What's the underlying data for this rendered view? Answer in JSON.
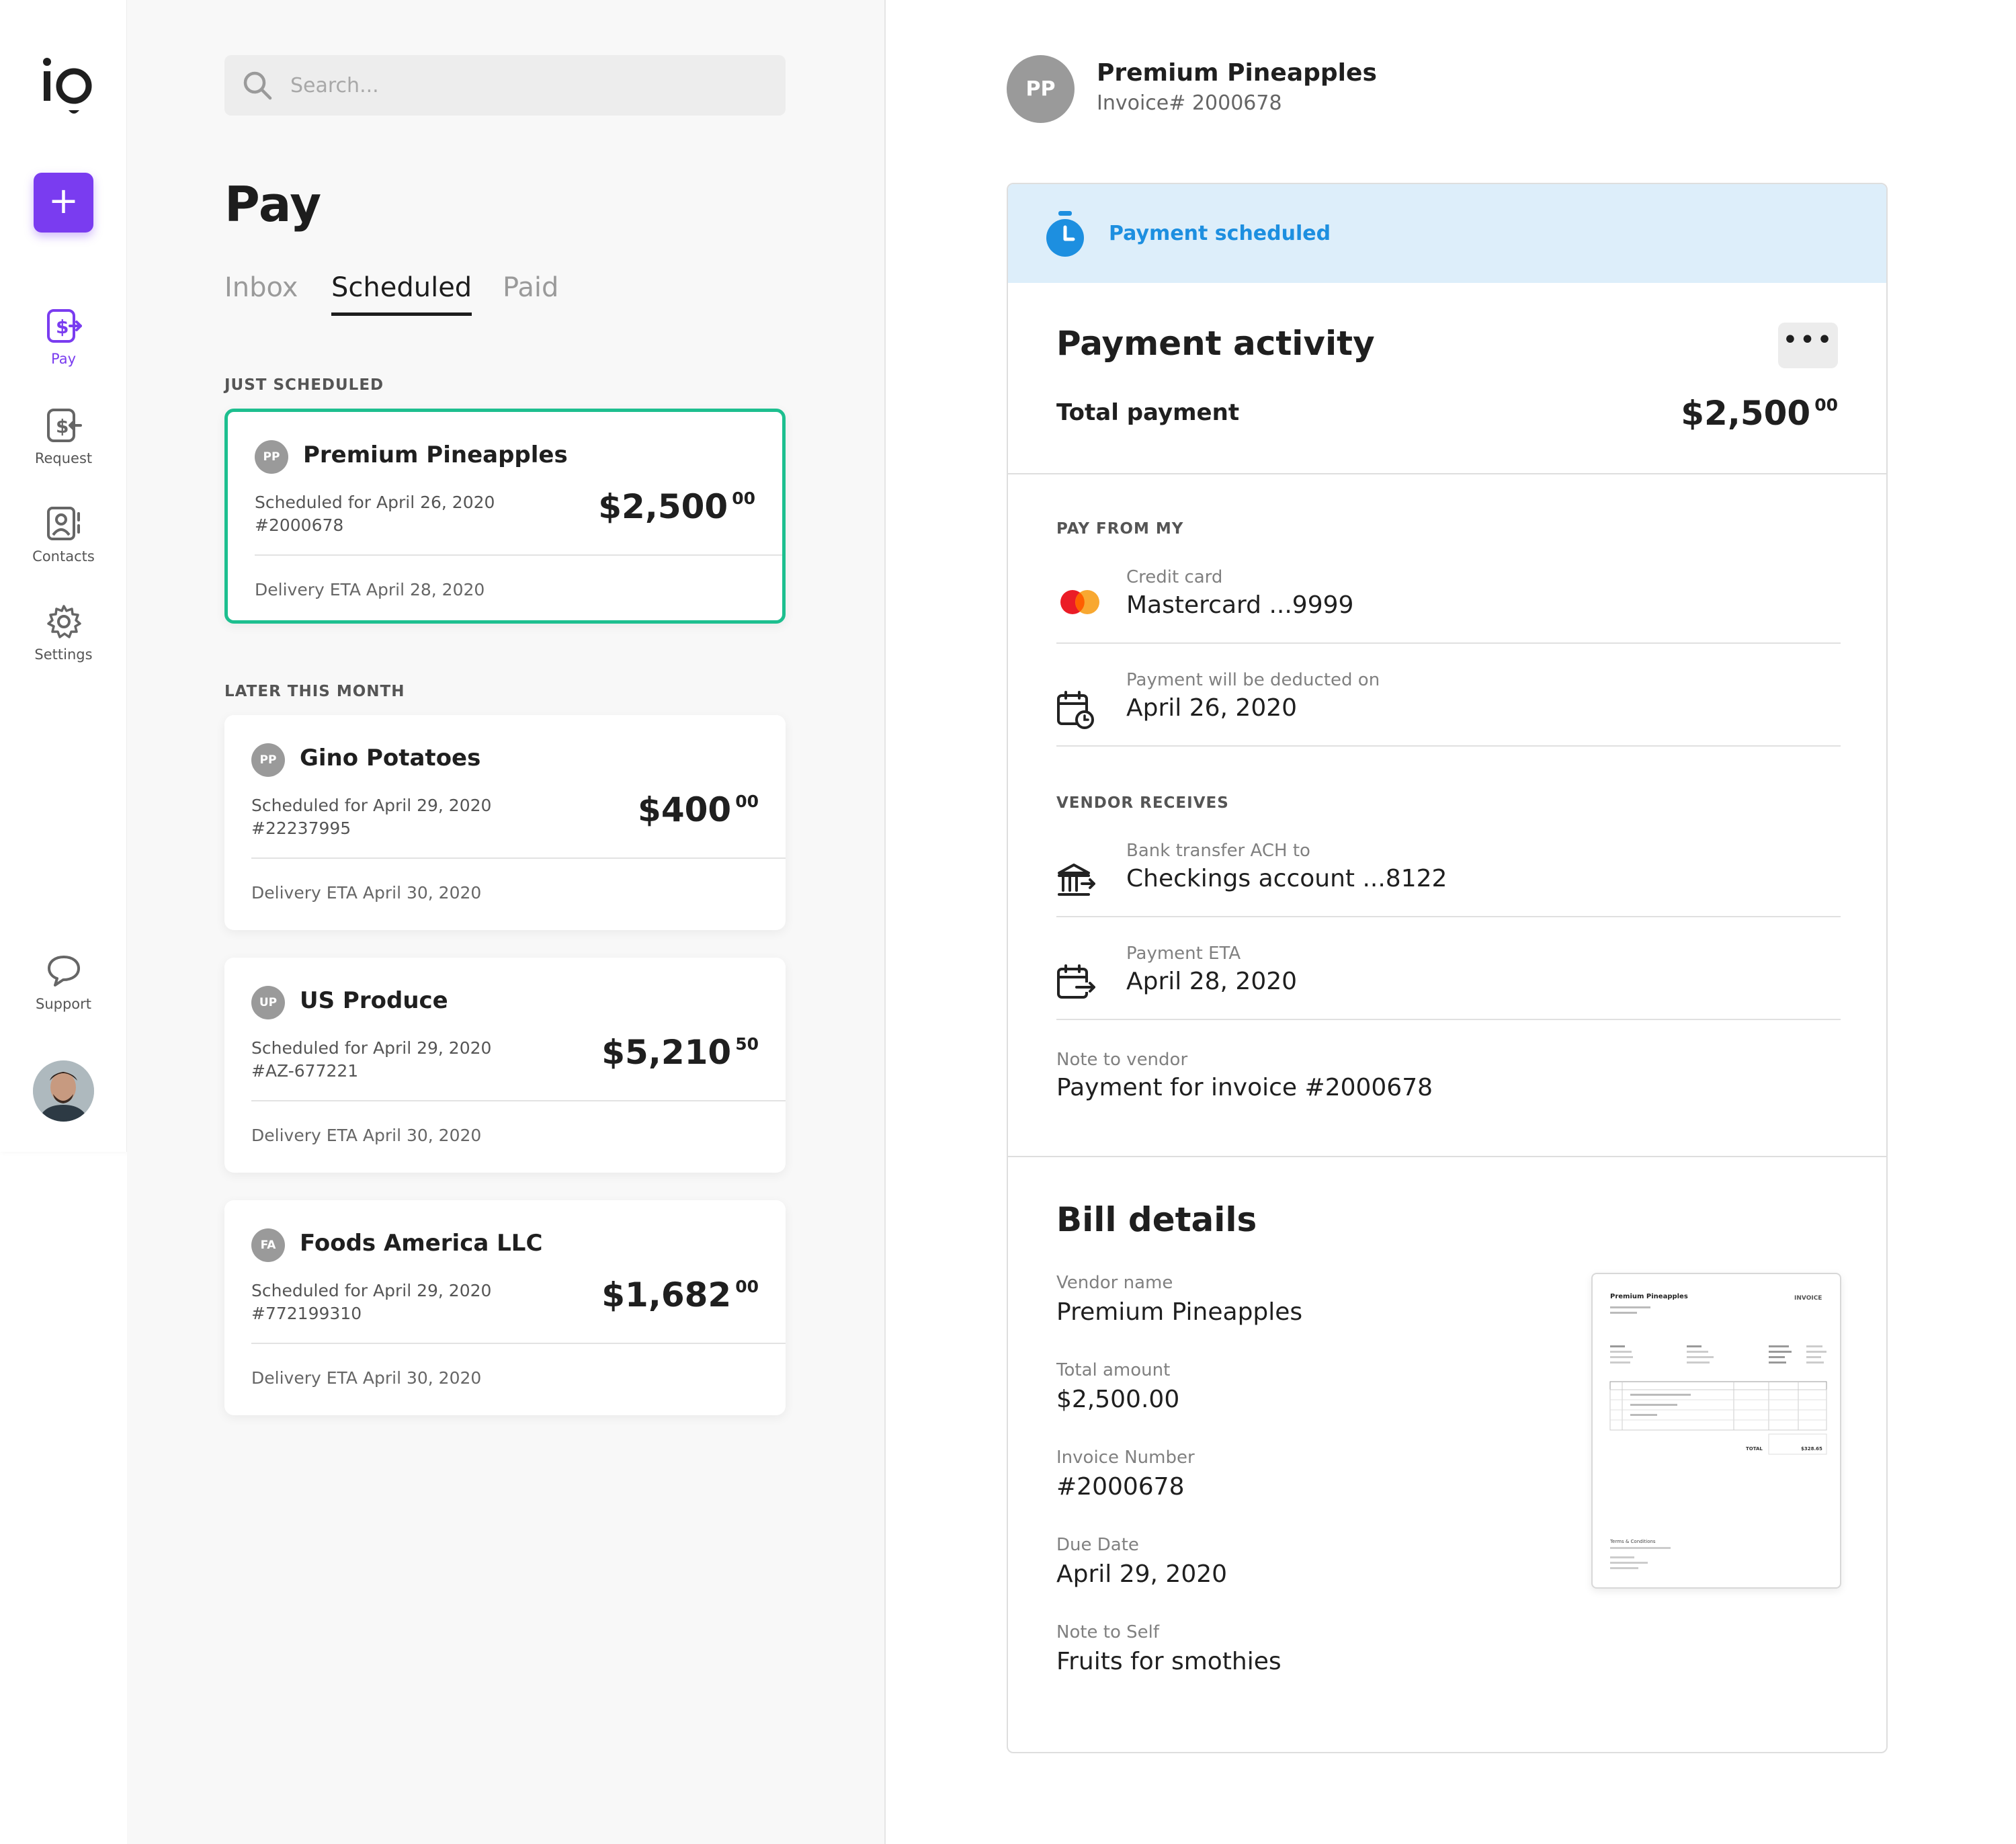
{
  "sidebar": {
    "new_label": "+",
    "items": [
      {
        "label": "Pay",
        "icon": "pay-icon"
      },
      {
        "label": "Request",
        "icon": "request-icon"
      },
      {
        "label": "Contacts",
        "icon": "contacts-icon"
      },
      {
        "label": "Settings",
        "icon": "gear-icon"
      }
    ],
    "support_label": "Support"
  },
  "search": {
    "placeholder": "Search..."
  },
  "page": {
    "title": "Pay"
  },
  "tabs": [
    {
      "label": "Inbox",
      "active": false
    },
    {
      "label": "Scheduled",
      "active": true
    },
    {
      "label": "Paid",
      "active": false
    }
  ],
  "sections": {
    "just_scheduled": "JUST SCHEDULED",
    "later_this_month": "LATER THIS MONTH"
  },
  "payments": [
    {
      "initials": "PP",
      "vendor": "Premium Pineapples",
      "scheduled": "Scheduled for April 26, 2020",
      "invoice": "#2000678",
      "amount_main": "$2,500",
      "amount_cents": "00",
      "eta": "Delivery ETA April 28, 2020"
    },
    {
      "initials": "PP",
      "vendor": "Gino Potatoes",
      "scheduled": "Scheduled for April 29, 2020",
      "invoice": "#22237995",
      "amount_main": "$400",
      "amount_cents": "00",
      "eta": "Delivery ETA April 30, 2020"
    },
    {
      "initials": "UP",
      "vendor": "US Produce",
      "scheduled": "Scheduled for April 29, 2020",
      "invoice": "#AZ-677221",
      "amount_main": "$5,210",
      "amount_cents": "50",
      "eta": "Delivery ETA April 30, 2020"
    },
    {
      "initials": "FA",
      "vendor": "Foods America LLC",
      "scheduled": "Scheduled for April 29, 2020",
      "invoice": "#772199310",
      "amount_main": "$1,682",
      "amount_cents": "00",
      "eta": "Delivery ETA April 30, 2020"
    }
  ],
  "detail": {
    "initials": "PP",
    "vendor": "Premium Pineapples",
    "invoice": "Invoice# 2000678",
    "status": "Payment scheduled",
    "activity_title": "Payment activity",
    "more_label": "•••",
    "total_label": "Total payment",
    "total_main": "$2,500",
    "total_cents": "00",
    "pay_from_label": "PAY FROM MY",
    "credit_card_label": "Credit card",
    "credit_card_value": "Mastercard ...9999",
    "deduct_label": "Payment will be deducted on",
    "deduct_value": "April 26, 2020",
    "vendor_receives_label": "VENDOR RECEIVES",
    "bank_label": "Bank transfer ACH to",
    "bank_value": "Checkings account ...8122",
    "eta_label": "Payment ETA",
    "eta_value": "April 28, 2020",
    "note_vendor_label": "Note to vendor",
    "note_vendor_value": "Payment for invoice #2000678",
    "bill_title": "Bill details",
    "vendor_name_label": "Vendor name",
    "vendor_name_value": "Premium Pineapples",
    "total_amount_label": "Total amount",
    "total_amount_value": "$2,500.00",
    "invoice_number_label": "Invoice Number",
    "invoice_number_value": "#2000678",
    "due_date_label": "Due Date",
    "due_date_value": "April 29, 2020",
    "note_self_label": "Note to Self",
    "note_self_value": "Fruits for smothies"
  },
  "invoice_thumb": {
    "company": "Premium Pineapples",
    "doc_type": "INVOICE",
    "total_label": "TOTAL",
    "total_value": "$328.65",
    "terms": "Terms & Conditions"
  },
  "colors": {
    "accent": "#7a3cf0",
    "selected_border": "#1dbf8f",
    "status_blue": "#1d8fe0",
    "banner_bg": "#ddeefa"
  }
}
